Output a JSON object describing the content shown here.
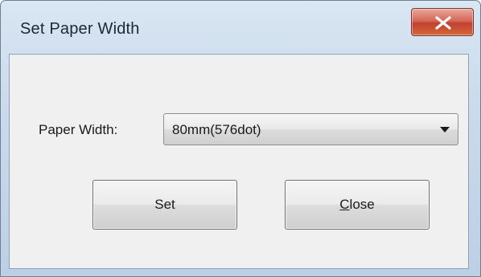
{
  "window": {
    "title": "Set Paper Width"
  },
  "titlebar": {
    "close_icon": "close-x-icon",
    "close_color": "#c8463a"
  },
  "form": {
    "paper_width_label": "Paper Width:",
    "paper_width_value": "80mm(576dot)"
  },
  "buttons": {
    "set_label": "Set",
    "close_mnemonic": "C",
    "close_rest": "lose"
  }
}
